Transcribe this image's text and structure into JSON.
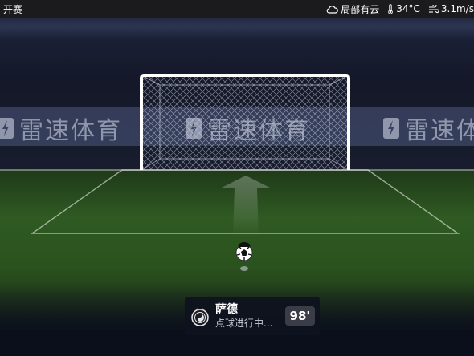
{
  "status_bar": {
    "match_status": "开赛",
    "weather": "局部有云",
    "temperature": "34°C",
    "wind": "3.1m/s"
  },
  "watermark": {
    "text": "雷速体育"
  },
  "event_card": {
    "team": "萨德",
    "event": "点球进行中...",
    "minute": "98'"
  },
  "colors": {
    "pitch": "#2f5a22",
    "stand_band": "#3a4361",
    "goal_frame": "#ffffff"
  },
  "icons": {
    "weather": "cloud-icon",
    "temperature": "thermometer-icon",
    "wind": "wind-icon",
    "ball": "football-icon",
    "team_logo": "team-crest-icon"
  }
}
